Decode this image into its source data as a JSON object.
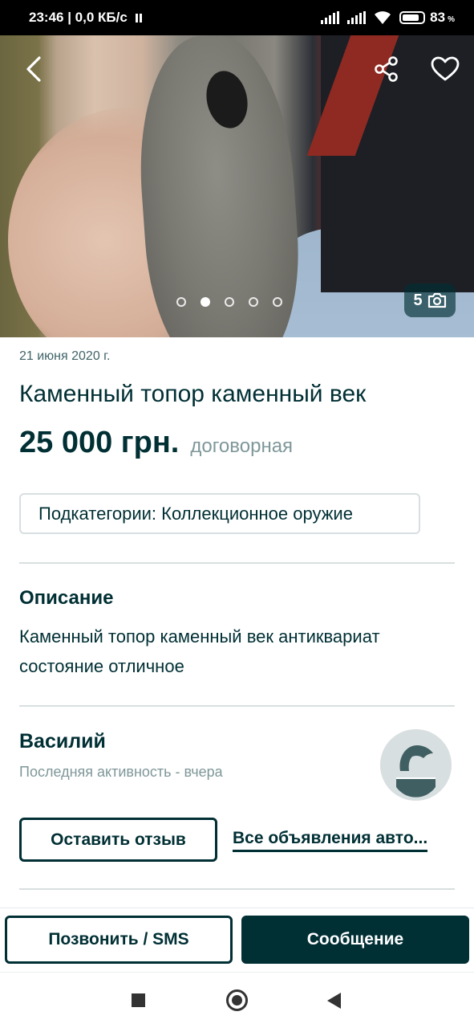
{
  "status_bar": {
    "time_info": "23:46 | 0,0 КБ/с",
    "battery_percent": "83",
    "battery_sign": "%"
  },
  "gallery": {
    "photo_count": "5",
    "dots_total": 5,
    "active_dot": 1,
    "icons": {
      "back": "chevron-left-icon",
      "share": "share-icon",
      "favorite": "heart-icon",
      "camera": "camera-icon"
    }
  },
  "listing": {
    "date": "21 июня 2020 г.",
    "title": "Каменный топор каменный век",
    "price": "25 000 грн.",
    "price_note": "договорная",
    "subcategory": "Подкатегории: Коллекционное оружие"
  },
  "description": {
    "heading": "Описание",
    "text": "Каменный топор каменный век антиквариат состояние отличное"
  },
  "seller": {
    "name": "Василий",
    "activity": "Последняя активность - вчера",
    "review_button": "Оставить отзыв",
    "all_ads_link": "Все объявления авто..."
  },
  "actions": {
    "call_button": "Позвонить / SMS",
    "message_button": "Сообщение"
  },
  "colors": {
    "primary": "#002f34",
    "muted": "#7f9799",
    "divider": "#d8dfe0"
  }
}
